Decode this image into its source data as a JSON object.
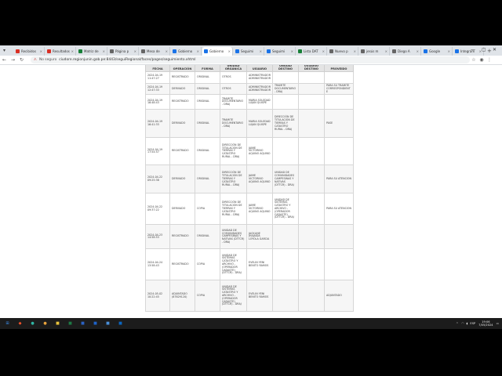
{
  "browser": {
    "tabs": [
      {
        "label": "Recibidos",
        "color": "#d93025"
      },
      {
        "label": "Resultados",
        "color": "#d93025"
      },
      {
        "label": "Matriz de",
        "color": "#188038"
      },
      {
        "label": "Página p",
        "color": "#666666"
      },
      {
        "label": "Mesa de",
        "color": "#666666"
      },
      {
        "label": "Gobierno",
        "color": "#1a73e8"
      },
      {
        "label": "Gobierno",
        "color": "#1a73e8",
        "active": true
      },
      {
        "label": "Seguimi",
        "color": "#1a73e8"
      },
      {
        "label": "Seguimi",
        "color": "#1a73e8"
      },
      {
        "label": "Lista DAT",
        "color": "#188038"
      },
      {
        "label": "Nuevo p",
        "color": "#666666"
      },
      {
        "label": "jesús m",
        "color": "#666666"
      },
      {
        "label": "Diego A",
        "color": "#666666"
      },
      {
        "label": "Google",
        "color": "#1a73e8"
      },
      {
        "label": "Integram",
        "color": "#1a73e8"
      }
    ],
    "new_tab": "+",
    "url_warning": "No seguro",
    "url": "ciudore.regionjunin.gob.pe:8443/seguiRegional/faces/pages/seguimiento.xhtml"
  },
  "table": {
    "headers": [
      "FECHA",
      "OPERACIÓN",
      "FORMA",
      "UNIDAD ORGÁNICA",
      "USUARIO",
      "UNIDAD DESTINO",
      "USUARIO DESTINO",
      "PROVEIDO"
    ],
    "rows": [
      [
        "2024-04-19 11:47:27",
        "REGISTRADO",
        "ORIGINAL",
        "OTROS",
        "ADMINISTRADOR ADMINISTRADOR",
        "",
        "",
        ""
      ],
      [
        "2024-04-19 12:47:33",
        "DERIVADO",
        "ORIGINAL",
        "OTROS",
        "ADMINISTRADOR ADMINISTRADOR",
        "TRAMITE DOCUMENTARIO - DRAJ",
        "",
        "PARA SU TRAMITE CORRESPONDIENTE"
      ],
      [
        "2024-04-19 16:48:43",
        "REGISTRADO",
        "ORIGINAL",
        "TRAMITE DOCUMENTARIO - DRAJ",
        "MARIA SOLEDAD LUJAN QUISPE",
        "",
        "",
        ""
      ],
      [
        "2024-04-19 16:41:33",
        "DERIVADO",
        "ORIGINAL",
        "TRAMITE DOCUMENTARIO - DRAJ",
        "MARIA SOLEDAD LUJAN QUISPE",
        "DIRECCIÓN DE TITULACIÓN DE TIERRAS Y CATASTRO RURAL - DRAJ",
        "",
        "PASE"
      ],
      [
        "2024-04-19 17:54:57",
        "REGISTRADO",
        "ORIGINAL",
        "DIRECCIÓN DE TITULACIÓN DE TIERRAS Y CATASTRO RURAL - DRAJ",
        "JAIME VICTORINO AQUINO AQUINO",
        "",
        "",
        ""
      ],
      [
        "2024-04-22 09:25:38",
        "DERIVADO",
        "ORIGINAL",
        "DIRECCIÓN DE TITULACIÓN DE TIERRAS Y CATASTRO RURAL - DRAJ",
        "JAIME VICTORINO AQUINO AQUINO",
        "UNIDAD DE COMUNIDADES CAMPESINAS Y NATIVAS (DTTCR) - DRAJ",
        "",
        "PARA SU ATENCION"
      ],
      [
        "2024-04-22 09:37:22",
        "DERIVADO",
        "COPIA",
        "DIRECCIÓN DE TITULACIÓN DE TIERRAS Y CATASTRO RURAL - DRAJ",
        "JAIME VICTORINO AQUINO AQUINO",
        "UNIDAD DE SISTEMAS CATASTRO Y ARCHIVO - (OPERADOR CADASTE) (DTTCR) - DRAJ",
        "",
        "PARA SU ATENCION"
      ],
      [
        "2024-04-23 14:58:53",
        "REGISTRADO",
        "ORIGINAL",
        "UNIDAD DE COMUNIDADES CAMPESINAS Y NATIVAS (DTTCR) - DRAJ",
        "JACKLINE JHAJAIDA LOYOLA GARCIA",
        "",
        "",
        ""
      ],
      [
        "2024-04-24 13:58:43",
        "REGISTRADO",
        "COPIA",
        "UNIDAD DE SISTEMAS CATASTRO Y ARCHIVO - (OPERADOR CADASTE) (DTTCR) - DRAJ",
        "EVELIN YENI BENITO RAMOS",
        "",
        "",
        ""
      ],
      [
        "2024-05-02 10:22:45",
        "ADJUNTADO (87629120)",
        "COPIA",
        "UNIDAD DE SISTEMAS CATASTRO Y ARCHIVO - (OPERADOR CADASTE) (DTTCR) - DRAJ",
        "EVELIN YENI BENITO RAMOS",
        "",
        "",
        "ADJUNTADO"
      ]
    ]
  },
  "taskbar": {
    "apps": [
      {
        "name": "start",
        "glyph": "⊞",
        "color": "#3b8eea"
      },
      {
        "name": "brave",
        "glyph": "◆",
        "color": "#fb542b"
      },
      {
        "name": "edge",
        "glyph": "●",
        "color": "#2fb6a4"
      },
      {
        "name": "chrome",
        "glyph": "●",
        "color": "#e8a33d"
      },
      {
        "name": "explorer",
        "glyph": "■",
        "color": "#e8c33d"
      },
      {
        "name": "excel",
        "glyph": "■",
        "color": "#1d7a45"
      },
      {
        "name": "word",
        "glyph": "■",
        "color": "#2b62c4"
      },
      {
        "name": "lenovo",
        "glyph": "■",
        "color": "#1f63c8"
      },
      {
        "name": "store",
        "glyph": "■",
        "color": "#4a90d9"
      },
      {
        "name": "mail",
        "glyph": "■",
        "color": "#0a66c2"
      }
    ],
    "language": "ESP",
    "time": "19:06",
    "date": "7/05/2024"
  }
}
